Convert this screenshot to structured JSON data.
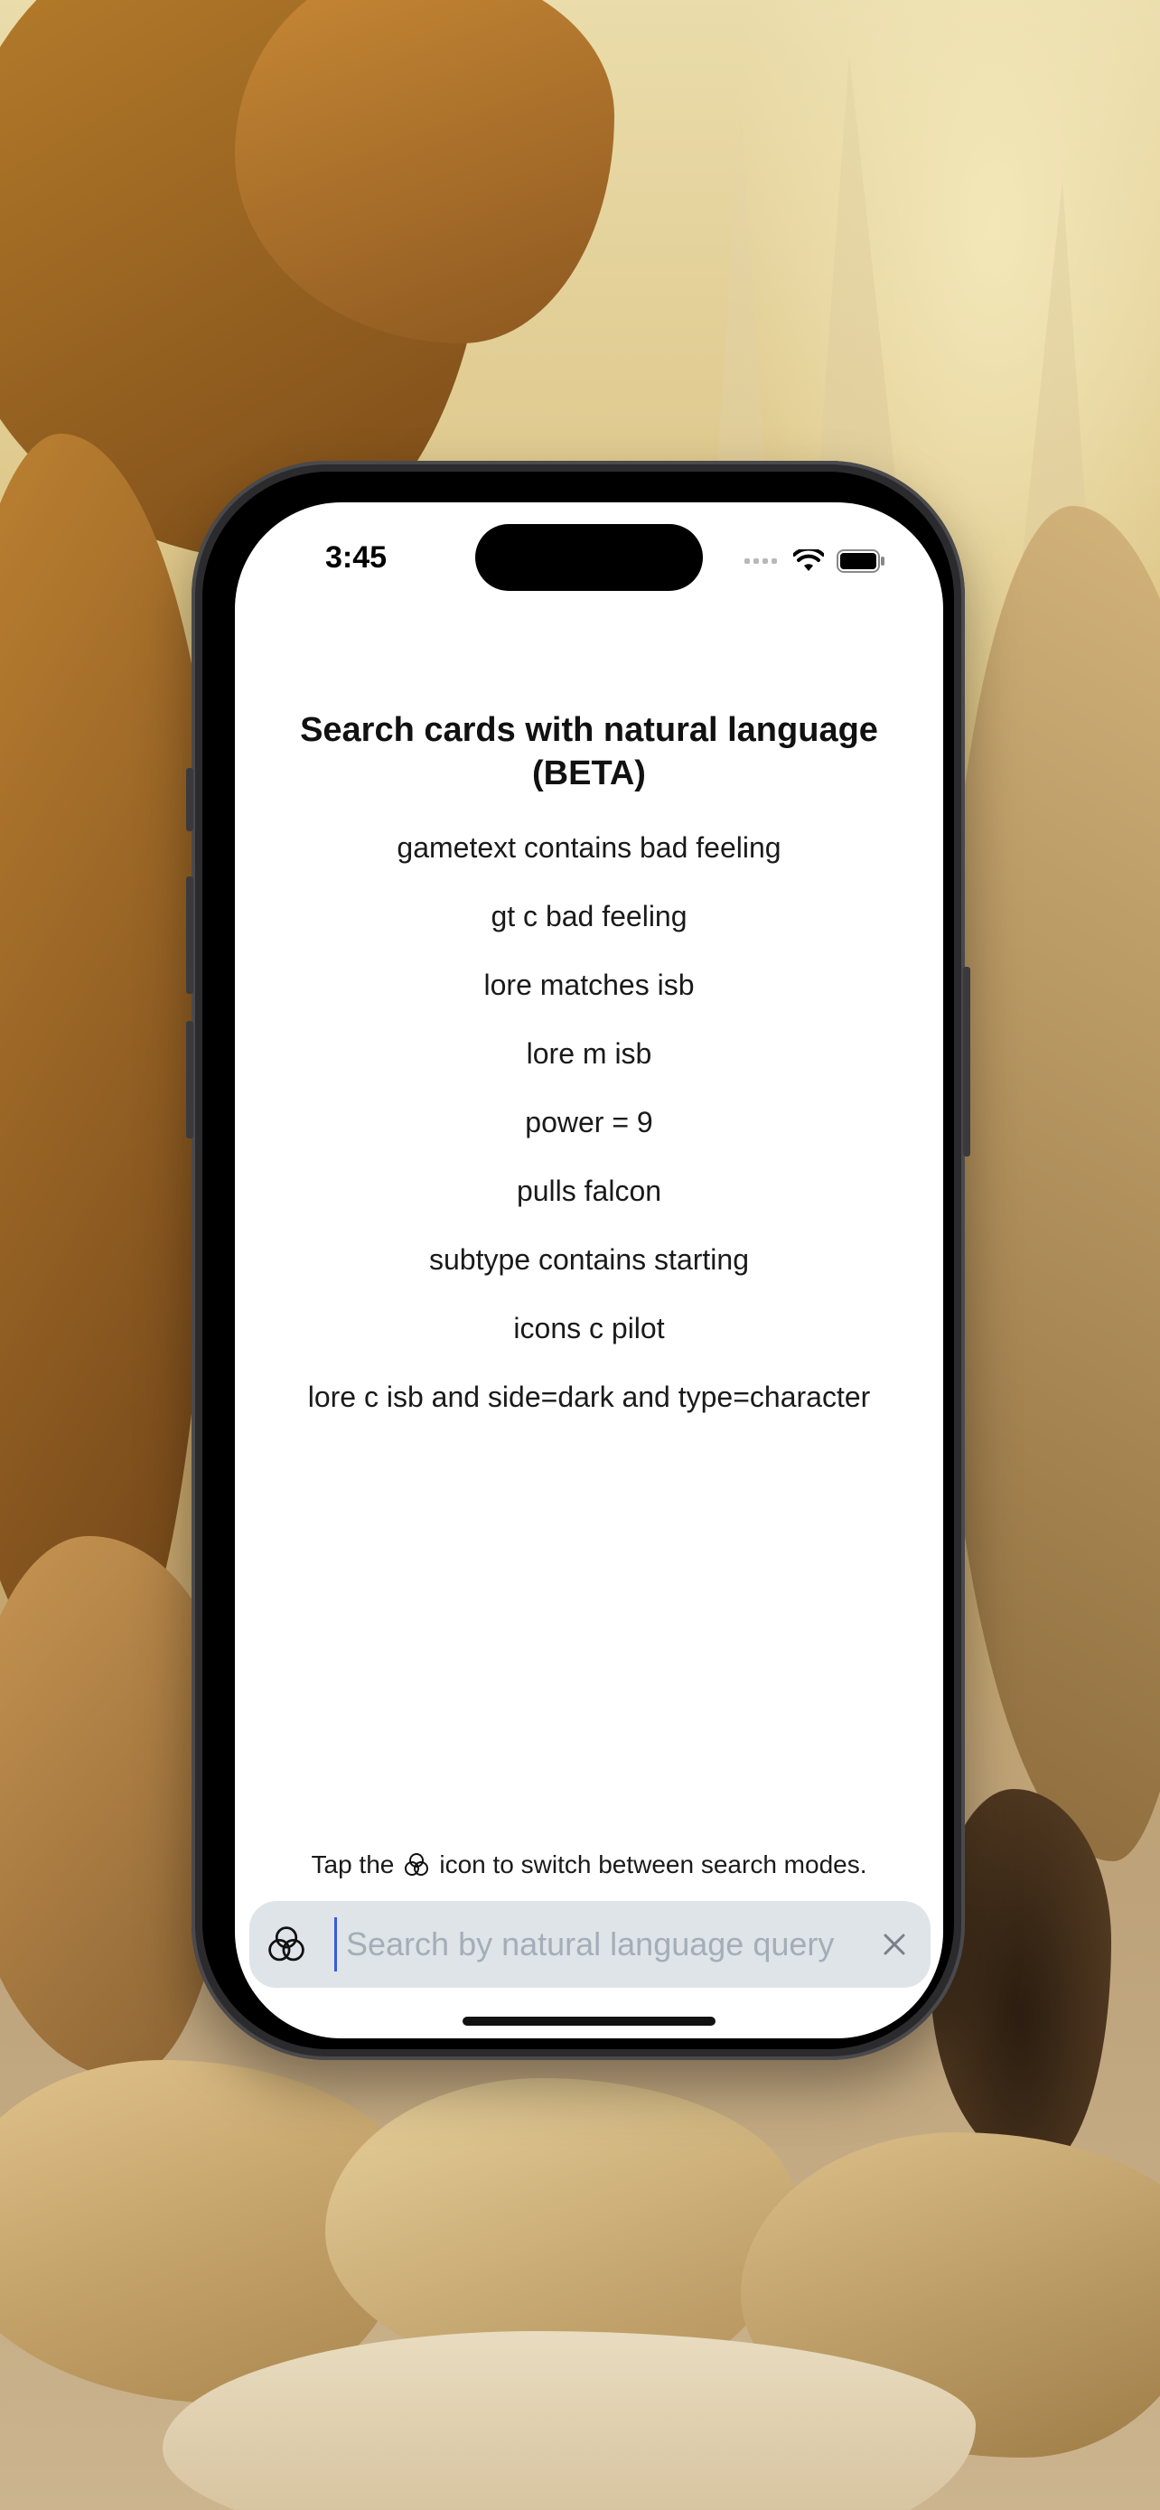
{
  "status_bar": {
    "time": "3:45"
  },
  "page": {
    "title": "Search cards with natural language (BETA)"
  },
  "examples": [
    "gametext contains bad feeling",
    "gt c bad feeling",
    "lore matches isb",
    "lore m isb",
    "power = 9",
    "pulls falcon",
    "subtype contains starting",
    "icons c pilot",
    "lore c isb and side=dark and type=character"
  ],
  "hint": {
    "before": "Tap the",
    "after": "icon to switch between search modes.",
    "icon": "venn-rings-icon"
  },
  "search": {
    "placeholder": "Search by natural language query",
    "value": "",
    "mode_icon": "venn-rings-icon",
    "clear_icon": "close-icon"
  },
  "colors": {
    "search_bar_bg": "#dfe4e8",
    "cursor": "#3b5bdb",
    "placeholder": "#a4adb8"
  }
}
